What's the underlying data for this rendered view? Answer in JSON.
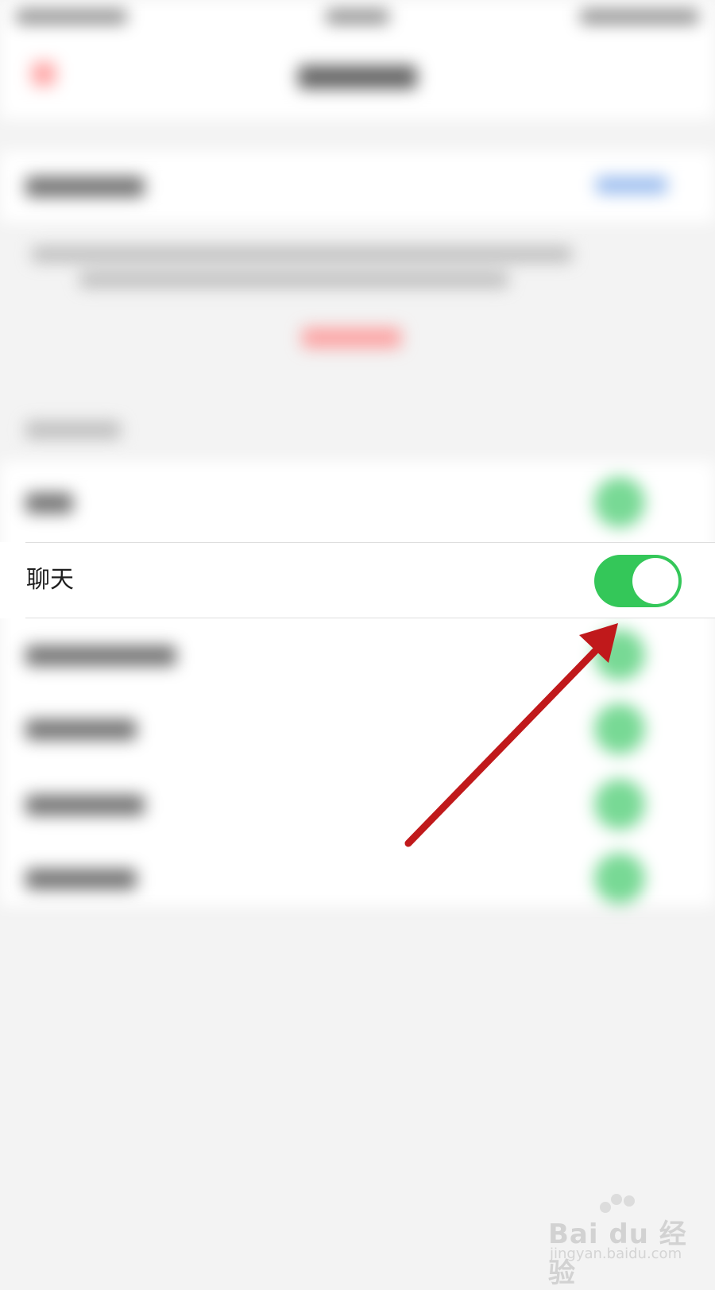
{
  "row": {
    "label": "聊天",
    "toggle_on": true
  },
  "colors": {
    "toggle_on": "#34c759",
    "annotation_arrow": "#c0191b"
  },
  "watermark": {
    "main": "Bai du 经验",
    "sub": "jingyan.baidu.com"
  }
}
